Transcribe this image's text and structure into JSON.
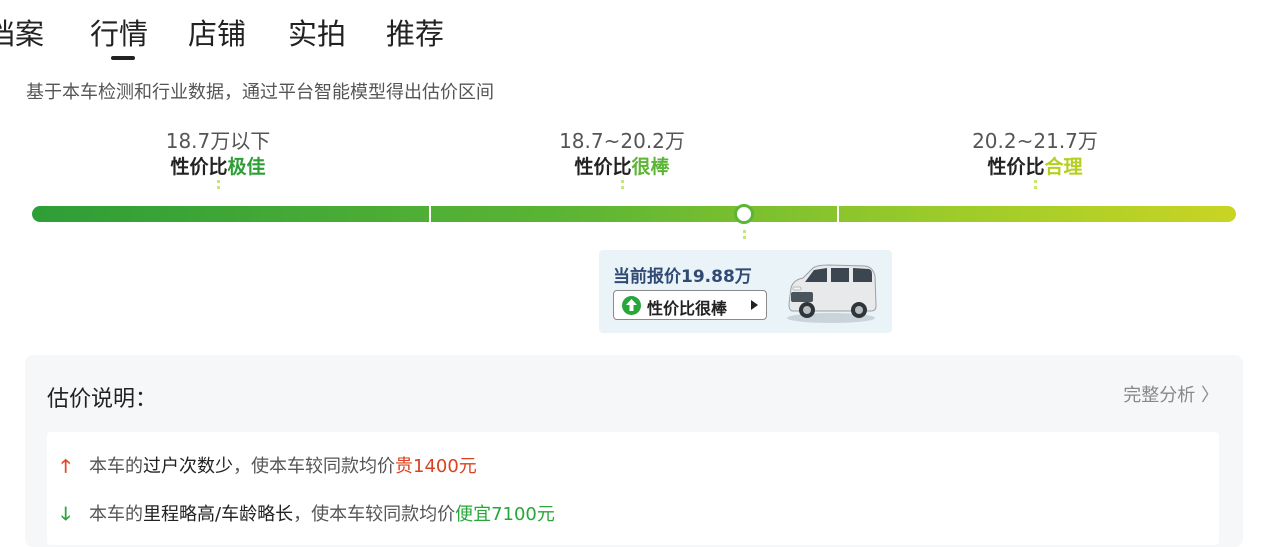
{
  "tabs": [
    {
      "label": "档案",
      "active": false
    },
    {
      "label": "行情",
      "active": true
    },
    {
      "label": "店铺",
      "active": false
    },
    {
      "label": "实拍",
      "active": false
    },
    {
      "label": "推荐",
      "active": false
    }
  ],
  "subtitle": "基于本车检测和行业数据，通过平台智能模型得出估价区间",
  "zones": [
    {
      "range": "18.7万以下",
      "label_prefix": "性价比",
      "label_rating": "极佳",
      "rating_color": "#2e9e37"
    },
    {
      "range": "18.7~20.2万",
      "label_prefix": "性价比",
      "label_rating": "很棒",
      "rating_color": "#5cb534"
    },
    {
      "range": "20.2~21.7万",
      "label_prefix": "性价比",
      "label_rating": "合理",
      "rating_color": "#b5cf1e"
    }
  ],
  "current": {
    "price_label": "当前报价19.88万",
    "price_value": 19.88,
    "rating_label": "性价比很棒"
  },
  "panel": {
    "title": "估价说明：",
    "full_analysis": "完整分析 〉",
    "rows": [
      {
        "direction": "up",
        "prefix": "本车的",
        "highlight": "过户次数少",
        "middle": "，使本车较同款均价",
        "effect": "贵1400元"
      },
      {
        "direction": "down",
        "prefix": "本车的",
        "highlight": "里程略高/车龄略长",
        "middle": "，使本车较同款均价",
        "effect": "便宜7100元"
      }
    ]
  },
  "colors": {
    "bar_start": "#2e9e37",
    "bar_end": "#c9d424",
    "price_text": "#304a74",
    "up_arrow": "#e04a2a",
    "down_arrow": "#27a63a"
  }
}
